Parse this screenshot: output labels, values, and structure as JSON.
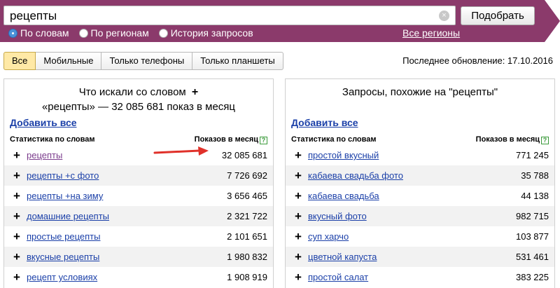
{
  "search": {
    "query": "рецепты",
    "clear_glyph": "×",
    "submit_label": "Подобрать",
    "modes": [
      {
        "label": "По словам",
        "checked": true
      },
      {
        "label": "По регионам",
        "checked": false
      },
      {
        "label": "История запросов",
        "checked": false
      }
    ],
    "regions_label": "Все регионы"
  },
  "tabs": [
    "Все",
    "Мобильные",
    "Только телефоны",
    "Только планшеты"
  ],
  "update_text": "Последнее обновление: 17.10.2016",
  "left": {
    "title_line1": "Что искали со словом",
    "title_line1_plus": "+",
    "title_line2": "«рецепты» — 32 085 681 показ в месяц",
    "add_all": "Добавить все",
    "col_phrase": "Статистика по словам",
    "col_count": "Показов в месяц",
    "help_glyph": "?",
    "rows": [
      {
        "phrase": "рецепты",
        "count": "32 085 681"
      },
      {
        "phrase": "рецепты +с фото",
        "count": "7 726 692"
      },
      {
        "phrase": "рецепты +на зиму",
        "count": "3 656 465"
      },
      {
        "phrase": "домашние рецепты",
        "count": "2 321 722"
      },
      {
        "phrase": "простые рецепты",
        "count": "2 101 651"
      },
      {
        "phrase": "вкусные рецепты",
        "count": "1 980 832"
      },
      {
        "phrase": "рецепт условиях",
        "count": "1 908 919"
      }
    ]
  },
  "right": {
    "title": "Запросы, похожие на \"рецепты\"",
    "add_all": "Добавить все",
    "col_phrase": "Статистика по словам",
    "col_count": "Показов в месяц",
    "help_glyph": "?",
    "rows": [
      {
        "phrase": "простой вкусный",
        "count": "771 245"
      },
      {
        "phrase": "кабаева свадьба фото",
        "count": "35 788"
      },
      {
        "phrase": "кабаева свадьба",
        "count": "44 138"
      },
      {
        "phrase": "вкусный фото",
        "count": "982 715"
      },
      {
        "phrase": "суп харчо",
        "count": "103 877"
      },
      {
        "phrase": "цветной капуста",
        "count": "531 461"
      },
      {
        "phrase": "простой салат",
        "count": "383 225"
      }
    ]
  },
  "plus_glyph": "+",
  "colors": {
    "header": "#8b3a6b",
    "link": "#1a3fa8",
    "visited": "#7b3c8c",
    "arrow": "#e0312a",
    "active_tab": "#ffe9a6"
  }
}
